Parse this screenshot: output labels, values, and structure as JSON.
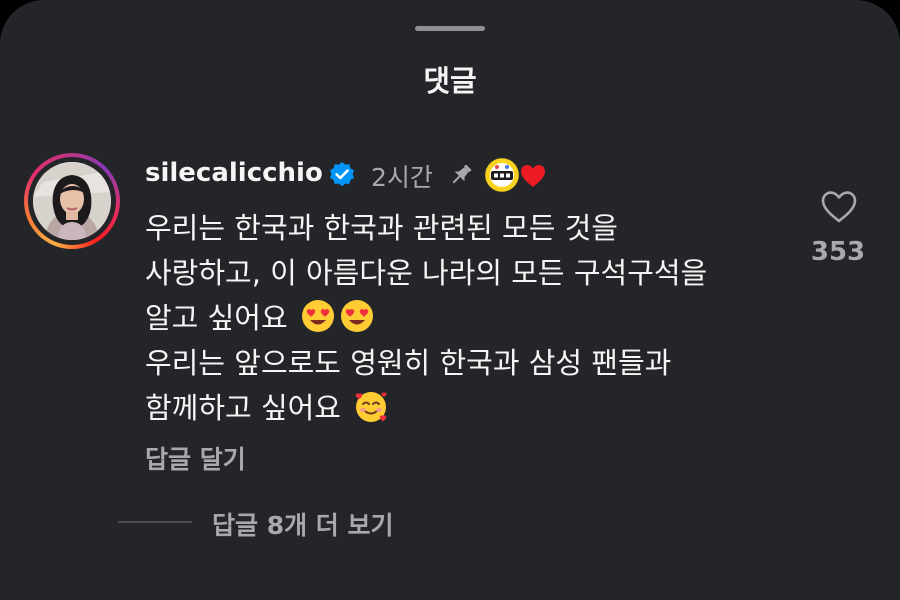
{
  "sheet": {
    "title": "댓글"
  },
  "comment": {
    "username": "silecalicchio",
    "timestamp": "2시간",
    "text_lines": [
      "우리는 한국과 한국과 관련된 모든 것을",
      "사랑하고, 이 아름다운 나라의 모든 구석구석을",
      "알고 싶어요",
      "우리는 앞으로도 영원히 한국과 삼성 팬들과",
      "함께하고 싶어요"
    ],
    "emojis": {
      "line3": [
        "heart-eyes-emoji",
        "heart-eyes-emoji"
      ],
      "line5": [
        "smiling-face-with-hearts-emoji"
      ]
    },
    "icons": {
      "verified": "verified-badge-icon",
      "pinned": "pin-icon",
      "creator_badge": "creator-badge-icon",
      "liked_by_creator": "heart-icon",
      "like": "heart-outline-icon"
    },
    "like_count": "353",
    "reply_label": "답글 달기",
    "view_replies_label": "답글 8개 더 보기"
  },
  "colors": {
    "background": "#242529",
    "text_primary": "#f5f5f5",
    "text_secondary": "#a8a8ad",
    "verified_blue": "#0095f6",
    "heart_red": "#ed1c24"
  }
}
